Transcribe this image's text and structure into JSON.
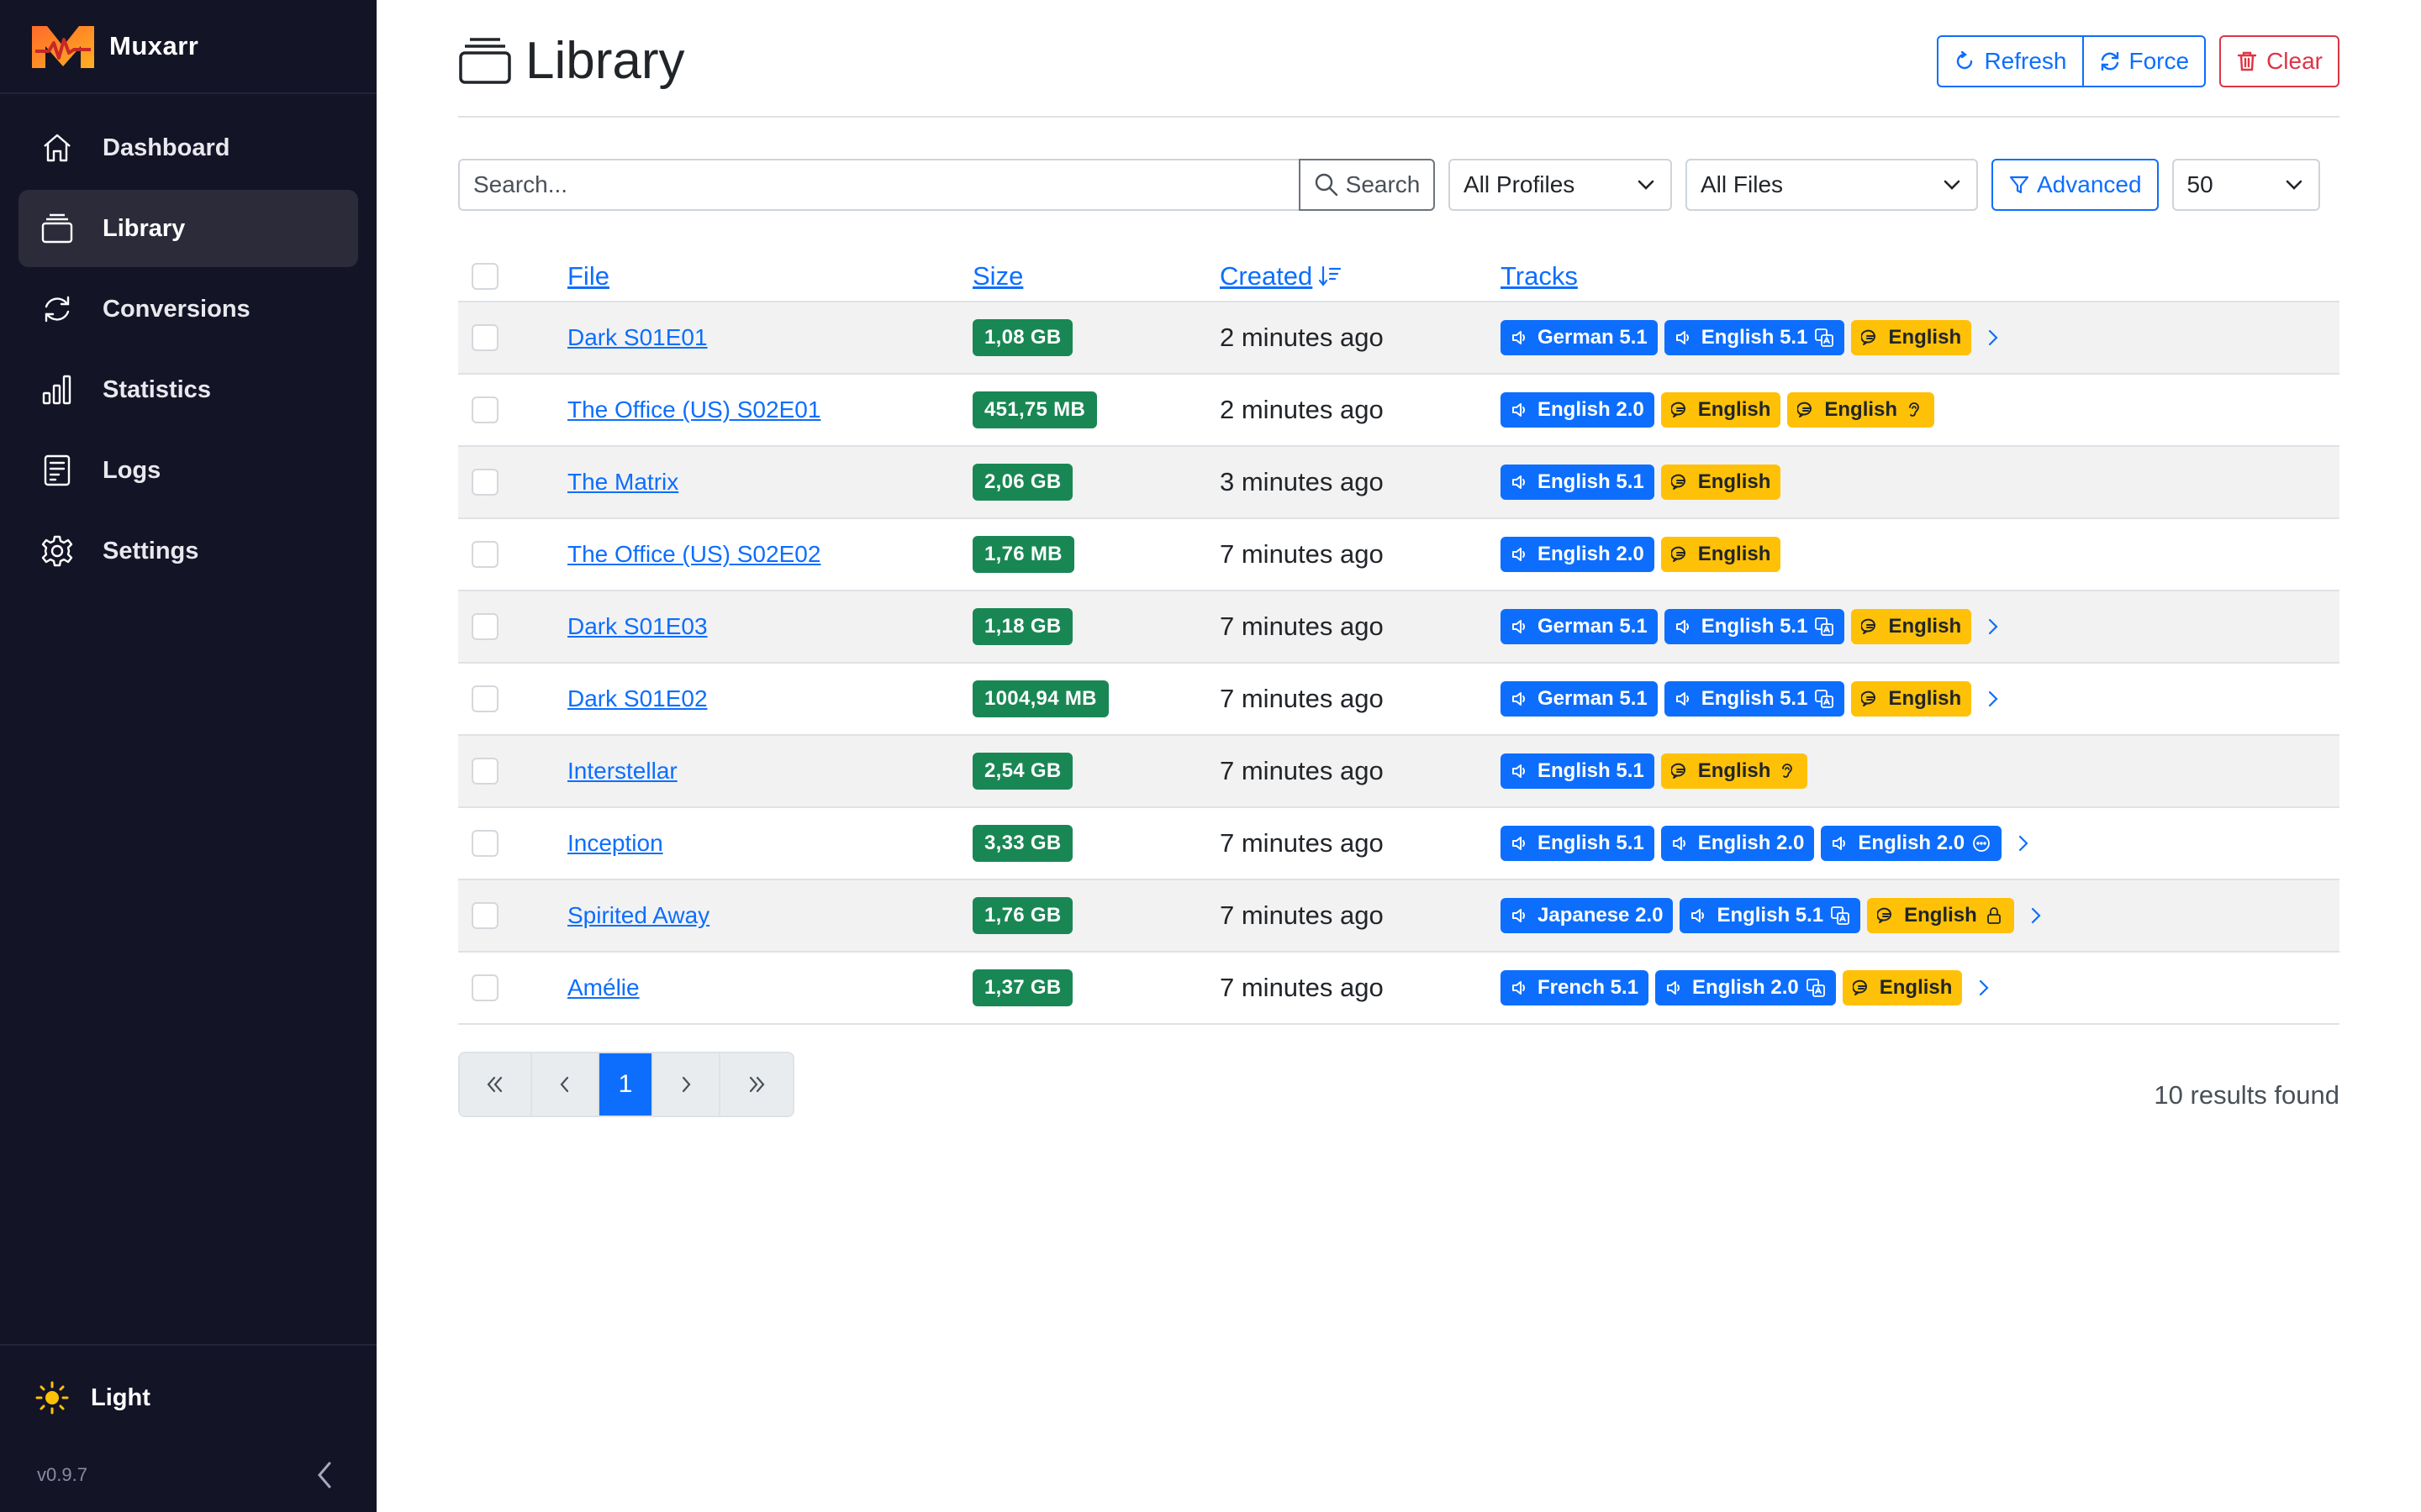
{
  "app": {
    "name": "Muxarr",
    "version": "v0.9.7"
  },
  "sidebar": {
    "items": [
      {
        "label": "Dashboard",
        "icon": "home-icon",
        "active": false
      },
      {
        "label": "Library",
        "icon": "library-icon",
        "active": true
      },
      {
        "label": "Conversions",
        "icon": "sync-icon",
        "active": false
      },
      {
        "label": "Statistics",
        "icon": "bar-chart-icon",
        "active": false
      },
      {
        "label": "Logs",
        "icon": "log-icon",
        "active": false
      },
      {
        "label": "Settings",
        "icon": "gear-icon",
        "active": false
      }
    ],
    "theme_label": "Light"
  },
  "header": {
    "title": "Library",
    "refresh_label": "Refresh",
    "force_label": "Force",
    "clear_label": "Clear"
  },
  "toolbar": {
    "search_placeholder": "Search...",
    "search_label": "Search",
    "profile_filter": "All Profiles",
    "file_filter": "All Files",
    "advanced_label": "Advanced",
    "page_size": "50"
  },
  "table": {
    "columns": {
      "file": "File",
      "size": "Size",
      "created": "Created",
      "tracks": "Tracks"
    },
    "rows": [
      {
        "file": "Dark S01E01",
        "size": "1,08 GB",
        "created": "2 minutes ago",
        "more": true,
        "tracks": [
          {
            "type": "audio",
            "label": "German 5.1"
          },
          {
            "type": "audio",
            "label": "English 5.1",
            "flag": "translate"
          },
          {
            "type": "sub",
            "label": "English"
          }
        ]
      },
      {
        "file": "The Office (US) S02E01",
        "size": "451,75 MB",
        "created": "2 minutes ago",
        "more": false,
        "tracks": [
          {
            "type": "audio",
            "label": "English 2.0"
          },
          {
            "type": "sub",
            "label": "English"
          },
          {
            "type": "sub",
            "label": "English",
            "flag": "hearing"
          }
        ]
      },
      {
        "file": "The Matrix",
        "size": "2,06 GB",
        "created": "3 minutes ago",
        "more": false,
        "tracks": [
          {
            "type": "audio",
            "label": "English 5.1"
          },
          {
            "type": "sub",
            "label": "English"
          }
        ]
      },
      {
        "file": "The Office (US) S02E02",
        "size": "1,76 MB",
        "created": "7 minutes ago",
        "more": false,
        "tracks": [
          {
            "type": "audio",
            "label": "English 2.0"
          },
          {
            "type": "sub",
            "label": "English"
          }
        ]
      },
      {
        "file": "Dark S01E03",
        "size": "1,18 GB",
        "created": "7 minutes ago",
        "more": true,
        "tracks": [
          {
            "type": "audio",
            "label": "German 5.1"
          },
          {
            "type": "audio",
            "label": "English 5.1",
            "flag": "translate"
          },
          {
            "type": "sub",
            "label": "English"
          }
        ]
      },
      {
        "file": "Dark S01E02",
        "size": "1004,94 MB",
        "created": "7 minutes ago",
        "more": true,
        "tracks": [
          {
            "type": "audio",
            "label": "German 5.1"
          },
          {
            "type": "audio",
            "label": "English 5.1",
            "flag": "translate"
          },
          {
            "type": "sub",
            "label": "English"
          }
        ]
      },
      {
        "file": "Interstellar",
        "size": "2,54 GB",
        "created": "7 minutes ago",
        "more": false,
        "tracks": [
          {
            "type": "audio",
            "label": "English 5.1"
          },
          {
            "type": "sub",
            "label": "English",
            "flag": "hearing"
          }
        ]
      },
      {
        "file": "Inception",
        "size": "3,33 GB",
        "created": "7 minutes ago",
        "more": true,
        "tracks": [
          {
            "type": "audio",
            "label": "English 5.1"
          },
          {
            "type": "audio",
            "label": "English 2.0"
          },
          {
            "type": "audio",
            "label": "English 2.0",
            "flag": "commentary"
          }
        ]
      },
      {
        "file": "Spirited Away",
        "size": "1,76 GB",
        "created": "7 minutes ago",
        "more": true,
        "tracks": [
          {
            "type": "audio",
            "label": "Japanese 2.0"
          },
          {
            "type": "audio",
            "label": "English 5.1",
            "flag": "translate"
          },
          {
            "type": "sub",
            "label": "English",
            "flag": "forced"
          }
        ]
      },
      {
        "file": "Amélie",
        "size": "1,37 GB",
        "created": "7 minutes ago",
        "more": true,
        "tracks": [
          {
            "type": "audio",
            "label": "French 5.1"
          },
          {
            "type": "audio",
            "label": "English 2.0",
            "flag": "translate"
          },
          {
            "type": "sub",
            "label": "English"
          }
        ]
      }
    ]
  },
  "pagination": {
    "current_page": "1",
    "results_text": "10 results found"
  },
  "colors": {
    "sidebar_bg": "#141427",
    "primary": "#0d6efd",
    "success": "#198754",
    "warning": "#ffc107",
    "danger": "#dc3545"
  }
}
